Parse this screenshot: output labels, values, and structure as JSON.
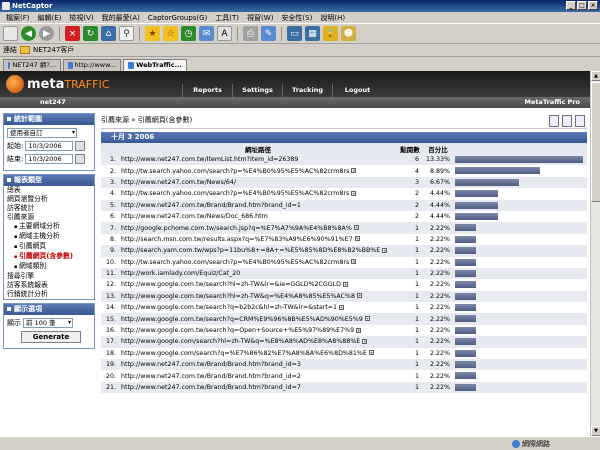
{
  "window": {
    "title": "NetCaptor",
    "buttons": [
      "_",
      "□",
      "×"
    ]
  },
  "menu": [
    "檔案(F)",
    "編輯(E)",
    "檢視(V)",
    "我的最愛(A)",
    "CaptorGroups(G)",
    "工具(T)",
    "視窗(W)",
    "安全性(S)",
    "說明(H)"
  ],
  "toolbar": {
    "icons": [
      "new-window",
      "back",
      "forward",
      "stop",
      "refresh",
      "home",
      "search",
      "favorites",
      "add-favorite",
      "history",
      "mail",
      "font-size",
      "print",
      "edit",
      "window",
      "tile",
      "lock",
      "popup-killer"
    ]
  },
  "favorites": {
    "label": "連結",
    "folder": "NET247客戶"
  },
  "tabs": [
    {
      "label": "NET247 網?...",
      "active": false
    },
    {
      "label": "http://www...",
      "active": false
    },
    {
      "label": "WebTraffic...",
      "active": true
    }
  ],
  "header": {
    "logo_main": "meta",
    "logo_accent": "TRAFFIC",
    "nav": [
      "Reports",
      "Settings",
      "Tracking",
      "Logout"
    ]
  },
  "strip": {
    "account": "net247",
    "product": "MetaTraffic Pro"
  },
  "sidebar": {
    "stats_range": {
      "title": "統計範圍",
      "select_value": "使用者自訂",
      "start_label": "起始:",
      "start_value": "10/3/2006",
      "end_label": "結束:",
      "end_value": "10/3/2006"
    },
    "report_types": {
      "title": "報表類型",
      "items": [
        {
          "label": "總表",
          "sub": false,
          "current": false
        },
        {
          "label": "網頁瀏覽分析",
          "sub": false,
          "current": false
        },
        {
          "label": "訪客統計",
          "sub": false,
          "current": false
        },
        {
          "label": "引薦來源",
          "sub": false,
          "current": false
        },
        {
          "label": "主要網域分析",
          "sub": true,
          "current": false
        },
        {
          "label": "網域主機分析",
          "sub": true,
          "current": false
        },
        {
          "label": "引薦網頁",
          "sub": true,
          "current": false
        },
        {
          "label": "引薦網頁(含參數)",
          "sub": true,
          "current": true
        },
        {
          "label": "網域類別",
          "sub": true,
          "current": false
        },
        {
          "label": "搜尋引擎",
          "sub": false,
          "current": false
        },
        {
          "label": "訪客系統報表",
          "sub": false,
          "current": false
        },
        {
          "label": "行銷統計分析",
          "sub": false,
          "current": false
        }
      ]
    },
    "display_options": {
      "title": "顯示選項",
      "show_label": "顯示",
      "show_value": "前 100 筆",
      "generate_label": "Generate"
    }
  },
  "main": {
    "breadcrumb": "引薦來源 » 引薦網頁(含參數)",
    "date_header": "十月 3 2006",
    "columns": {
      "url": "網址路徑",
      "visits": "點閱數",
      "percent": "百分比"
    },
    "rows": [
      {
        "n": "1.",
        "url": "http://www.net247.com.tw/ItemList.htm?item_id=26389",
        "expand": false,
        "visits": 6,
        "pct": "13.33%"
      },
      {
        "n": "2.",
        "url": "http://tw.search.yahoo.com/search?p=%E4%B0%95%E5%AC%82crm8rs",
        "expand": true,
        "visits": 4,
        "pct": "8.89%"
      },
      {
        "n": "3.",
        "url": "http://www.net247.com.tw/News/64/",
        "expand": false,
        "visits": 3,
        "pct": "6.67%"
      },
      {
        "n": "4.",
        "url": "http://tw.search.yahoo.com/search?p=%E4%B0%95%E5%AC%82crm8rs",
        "expand": true,
        "visits": 2,
        "pct": "4.44%"
      },
      {
        "n": "5.",
        "url": "http://www.net247.com.tw/Brand/Brand.htm?brand_id=1",
        "expand": false,
        "visits": 2,
        "pct": "4.44%"
      },
      {
        "n": "6.",
        "url": "http://www.net247.com.tw/News/Doc_686.htm",
        "expand": false,
        "visits": 2,
        "pct": "4.44%"
      },
      {
        "n": "7.",
        "url": "http://google.pchome.com.tw/search.jsp?q=%E7%A7%9A%E4%B8%8A%",
        "expand": true,
        "visits": 1,
        "pct": "2.22%"
      },
      {
        "n": "8.",
        "url": "http://search.msn.com.tw/results.aspx?q=%E7%83%A9%E6%90%91%E7",
        "expand": true,
        "visits": 1,
        "pct": "2.22%"
      },
      {
        "n": "9.",
        "url": "http://search.yam.com.tw/wps?p=11bu%8+=8A+=%E5%85%8D%E8%B2%BB%E",
        "expand": true,
        "visits": 1,
        "pct": "2.22%"
      },
      {
        "n": "10.",
        "url": "http://tw.search.yahoo.com/search?p=%E4%B0%95%E5%AC%82crm8rs",
        "expand": true,
        "visits": 1,
        "pct": "2.22%"
      },
      {
        "n": "11.",
        "url": "http://work.iamlady.com/Equiz/Cat_20",
        "expand": false,
        "visits": 1,
        "pct": "2.22%"
      },
      {
        "n": "12.",
        "url": "http://www.google.com.tw/search?hl=zh-TW&lr=&ie=GGLD%2CGGLD",
        "expand": true,
        "visits": 1,
        "pct": "2.22%"
      },
      {
        "n": "13.",
        "url": "http://www.google.com.tw/search?hl=zh-TW&q=%E4%A8%85%E5%AC%8",
        "expand": true,
        "visits": 1,
        "pct": "2.22%"
      },
      {
        "n": "14.",
        "url": "http://www.google.com.tw/search?q=b2b2c&hl=zh-TW&lr=&start=1",
        "expand": true,
        "visits": 1,
        "pct": "2.22%"
      },
      {
        "n": "15.",
        "url": "http://www.google.com.tw/search?q=CRM%E9%96%8B%E5%AD%90%E5%9",
        "expand": true,
        "visits": 1,
        "pct": "2.22%"
      },
      {
        "n": "16.",
        "url": "http://www.google.com.tw/search?q=Open+Source+%E5%97%89%E7%9",
        "expand": true,
        "visits": 1,
        "pct": "2.22%"
      },
      {
        "n": "17.",
        "url": "http://www.google.com/search?hl=zh-TW&q=%E8%A8%AD%E8%A8%88%E",
        "expand": true,
        "visits": 1,
        "pct": "2.22%"
      },
      {
        "n": "18.",
        "url": "http://www.google.com/search?q=%E7%86%82%E7%A8%8A%E6%8D%81%E",
        "expand": true,
        "visits": 1,
        "pct": "2.22%"
      },
      {
        "n": "19.",
        "url": "http://www.net247.com.tw/Brand/Brand.htm?brand_id=3",
        "expand": false,
        "visits": 1,
        "pct": "2.22%"
      },
      {
        "n": "20.",
        "url": "http://www.net247.com.tw/Brand/Brand.htm?brand_id=2",
        "expand": false,
        "visits": 1,
        "pct": "2.22%"
      },
      {
        "n": "21.",
        "url": "http://www.net247.com.tw/Brand/Brand.htm?brand_id=7",
        "expand": false,
        "visits": 1,
        "pct": "2.22%"
      }
    ]
  },
  "status": {
    "zone": "網際網路"
  }
}
